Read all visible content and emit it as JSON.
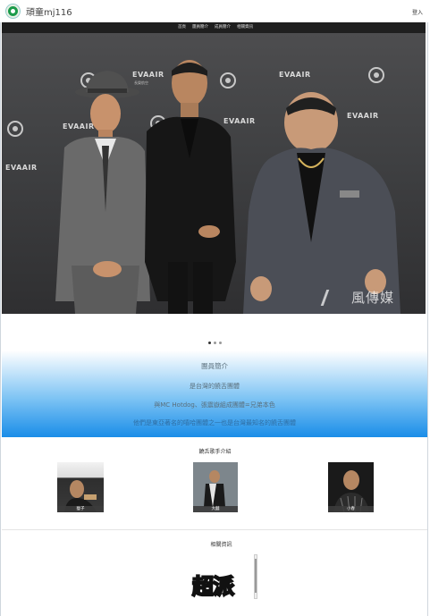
{
  "header": {
    "site_title": "頑童mj116",
    "login_label": "登入",
    "logo_icon": "circle-emblem-icon"
  },
  "nav": {
    "items": [
      "首頁",
      "團員簡介",
      "成員簡介",
      "相關資訊"
    ]
  },
  "hero": {
    "watermark": "風傳媒",
    "brand_text": "EVAAIR",
    "brand_sub": "長榮航空",
    "carousel_dots": 3,
    "active_dot": 0
  },
  "intro": {
    "heading": "團員簡介",
    "line1": "是台灣的饒舌團體",
    "line2": "與MC Hotdog、張震嶽組成團體=兄弟本色",
    "line3": "他們是東亞著名的嘻哈團體之一也是台灣最知名的饒舌團體"
  },
  "members": {
    "title": "饒舌歌手介紹",
    "items": [
      {
        "name": "瘦子"
      },
      {
        "name": "大囍"
      },
      {
        "name": "小春"
      }
    ]
  },
  "news": {
    "title": "相關資訊",
    "logo_text": "超派"
  },
  "colors": {
    "navbar": "#1f1f1f",
    "intro_gradient_end": "#1a8de8",
    "logo_green": "#1b9b4a"
  }
}
